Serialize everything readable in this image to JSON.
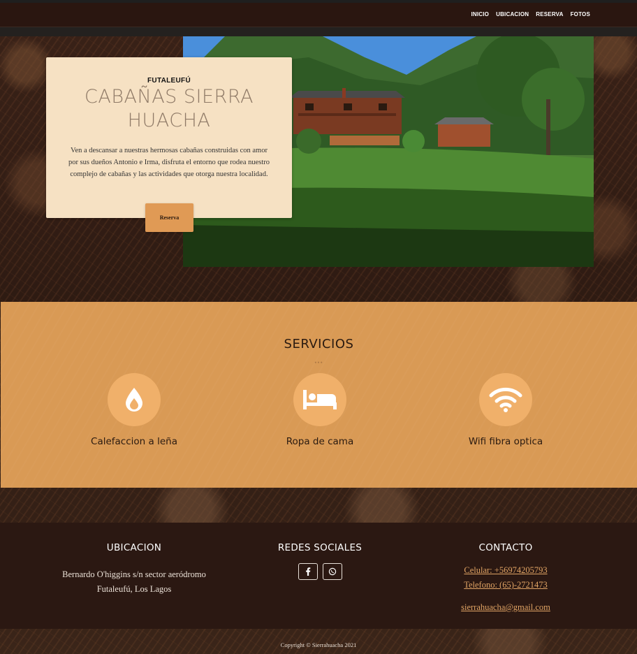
{
  "nav": {
    "items": [
      "INICIO",
      "UBICACION",
      "RESERVA",
      "FOTOS"
    ]
  },
  "hero": {
    "kicker": "FUTALEUFÚ",
    "title": "CABAÑAS SIERRA HUACHA",
    "text": "Ven a descansar a nuestras hermosas cabañas construidas con amor por sus dueños Antonio e Irma, disfruta el entorno que rodea nuestro complejo de cabañas y las actividades que otorga nuestra localidad.",
    "button_label": "Reserva"
  },
  "services": {
    "title": "SERVICIOS",
    "divider": "•••",
    "items": [
      {
        "label": "Calefaccion a leña",
        "icon": "fire-drop-icon"
      },
      {
        "label": "Ropa de cama",
        "icon": "bed-icon"
      },
      {
        "label": "Wifi fibra optica",
        "icon": "wifi-icon"
      }
    ]
  },
  "footer": {
    "location": {
      "heading": "UBICACION",
      "line1": "Bernardo O'higgins s/n sector aeródromo",
      "line2": "Futaleufú, Los Lagos"
    },
    "social": {
      "heading": "REDES SOCIALES",
      "icons": [
        "facebook-icon",
        "whatsapp-icon"
      ]
    },
    "contact": {
      "heading": "CONTACTO",
      "cell": "Celular: +56974205793",
      "phone": "Telefono: (65)-2721473",
      "email": "sierrahuacha@gmail.com"
    },
    "copyright": "Copyright © Sierrahuacha 2021"
  },
  "colors": {
    "accent": "#d99a55",
    "icon_circle": "#f0b06a",
    "card": "#f6e1c3",
    "footer_bg": "#2b1812",
    "link": "#e2a565"
  }
}
